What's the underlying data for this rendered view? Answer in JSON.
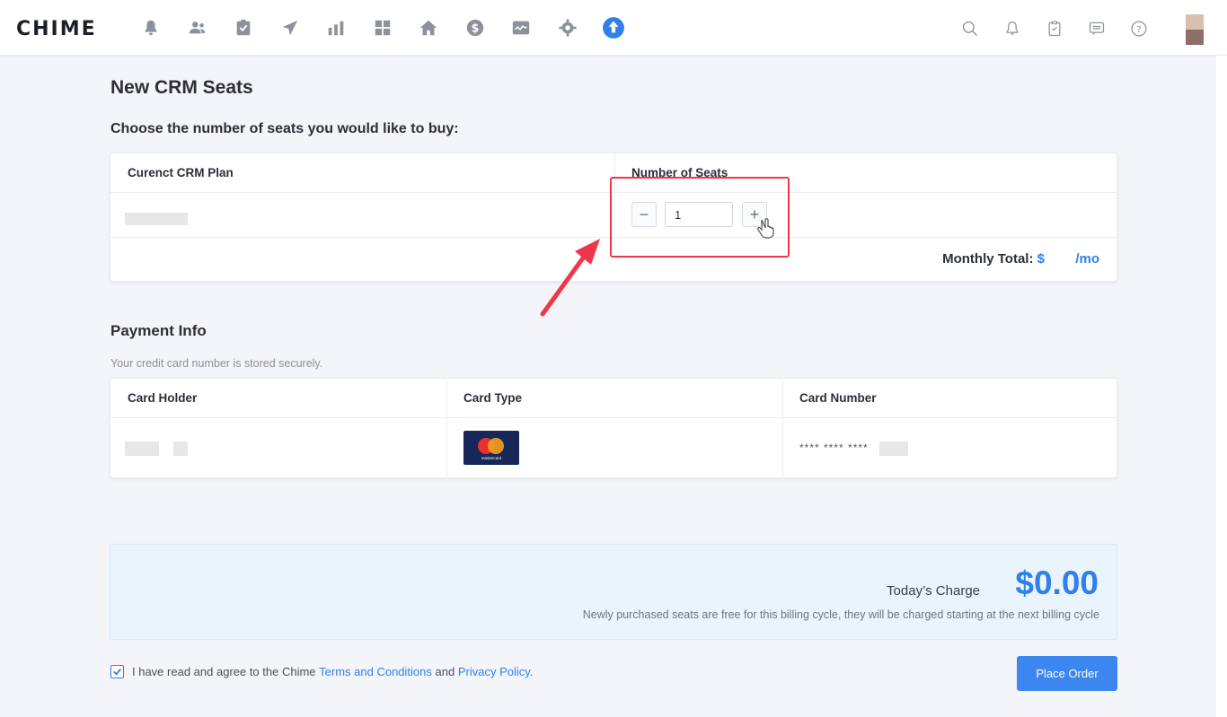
{
  "app": {
    "logo_text": "CHIME"
  },
  "nav": {
    "icons": [
      "bell-alert-icon",
      "contacts-icon",
      "tasks-icon",
      "send-icon",
      "reports-icon",
      "dashboard-icon",
      "listings-icon",
      "dollar-icon",
      "analytics-icon",
      "settings-icon",
      "upgrade-icon"
    ],
    "active_color": "#2f80ed",
    "icon_color": "#8c919b"
  },
  "header_right": {
    "icons": [
      "search-icon",
      "notification-icon",
      "clipboard-icon",
      "message-icon",
      "help-icon"
    ]
  },
  "page": {
    "title": "New CRM Seats",
    "subtitle": "Choose the number of seats you would like to buy:"
  },
  "seats_table": {
    "col_plan": "Curenct CRM Plan",
    "col_seats": "Number of Seats",
    "seat_value": "1",
    "minus_label": "−",
    "plus_label": "+",
    "monthly_label": "Monthly Total:",
    "currency": "$",
    "per_month": "/mo"
  },
  "payment": {
    "title": "Payment Info",
    "note": "Your credit card number is stored securely.",
    "col_holder": "Card Holder",
    "col_type": "Card Type",
    "col_number": "Card Number",
    "card_brand_text": "mastercard",
    "card_number_masked": "**** **** ****"
  },
  "charge": {
    "label": "Today’s Charge",
    "amount": "$0.00",
    "note": "Newly purchased seats are free for this  billing cycle, they will be charged starting at the next billing cycle"
  },
  "agreement": {
    "checked": true,
    "text_before": "I have read and agree to the Chime",
    "terms_link": "Terms and Conditions",
    "text_and": "and",
    "privacy_link": "Privacy Policy.",
    "order_button": "Place Order"
  },
  "colors": {
    "accent": "#2f80ed",
    "highlight_box": "#f0364a",
    "charge_bg": "#e9f4fd"
  }
}
